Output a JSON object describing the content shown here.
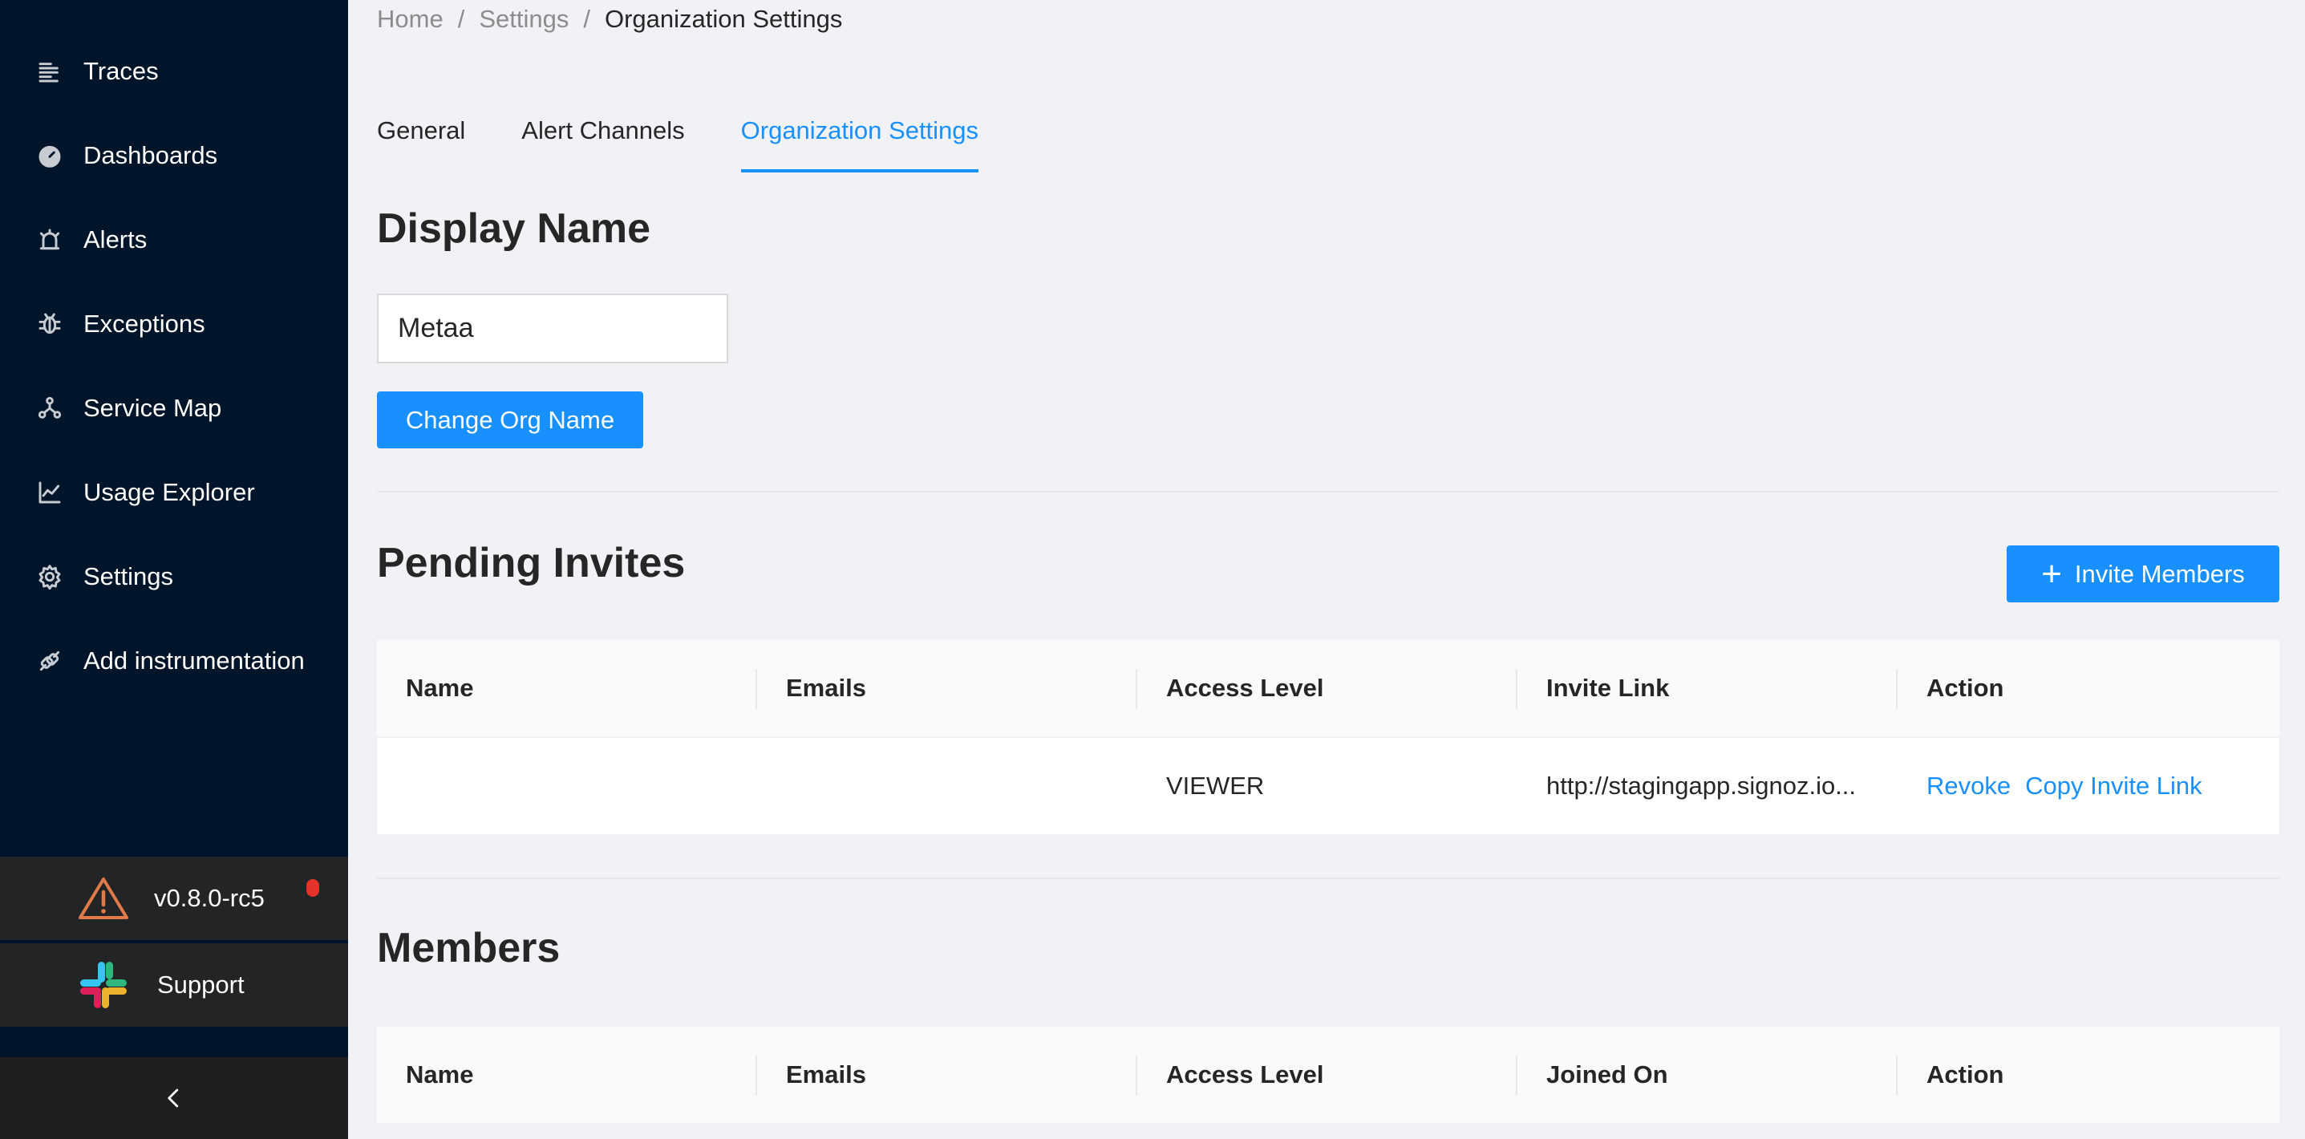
{
  "sidebar": {
    "items": [
      {
        "label": "Traces",
        "icon": "traces-icon"
      },
      {
        "label": "Dashboards",
        "icon": "dashboard-icon"
      },
      {
        "label": "Alerts",
        "icon": "alarm-icon"
      },
      {
        "label": "Exceptions",
        "icon": "bug-icon"
      },
      {
        "label": "Service Map",
        "icon": "deployment-unit-icon"
      },
      {
        "label": "Usage Explorer",
        "icon": "line-chart-icon"
      },
      {
        "label": "Settings",
        "icon": "gear-icon"
      },
      {
        "label": "Add instrumentation",
        "icon": "api-icon"
      }
    ],
    "version": "v0.8.0-rc5",
    "support": "Support"
  },
  "breadcrumb": {
    "home": "Home",
    "sep": "/",
    "settings": "Settings",
    "current": "Organization Settings"
  },
  "tabs": [
    {
      "label": "General",
      "active": false
    },
    {
      "label": "Alert Channels",
      "active": false
    },
    {
      "label": "Organization Settings",
      "active": true
    }
  ],
  "display_name": {
    "heading": "Display Name",
    "value": "Metaa",
    "button": "Change Org Name"
  },
  "pending_invites": {
    "heading": "Pending Invites",
    "invite_button": "Invite Members",
    "columns": [
      "Name",
      "Emails",
      "Access Level",
      "Invite Link",
      "Action"
    ],
    "rows": [
      {
        "name": "",
        "email": "",
        "access": "VIEWER",
        "link": "http://stagingapp.signoz.io...",
        "actions": [
          "Revoke",
          "Copy Invite Link"
        ]
      }
    ]
  },
  "members": {
    "heading": "Members",
    "columns": [
      "Name",
      "Emails",
      "Access Level",
      "Joined On",
      "Action"
    ]
  },
  "colors": {
    "sidebar_bg": "#001529",
    "accent": "#1890ff",
    "page_bg": "#f0f2f5"
  }
}
